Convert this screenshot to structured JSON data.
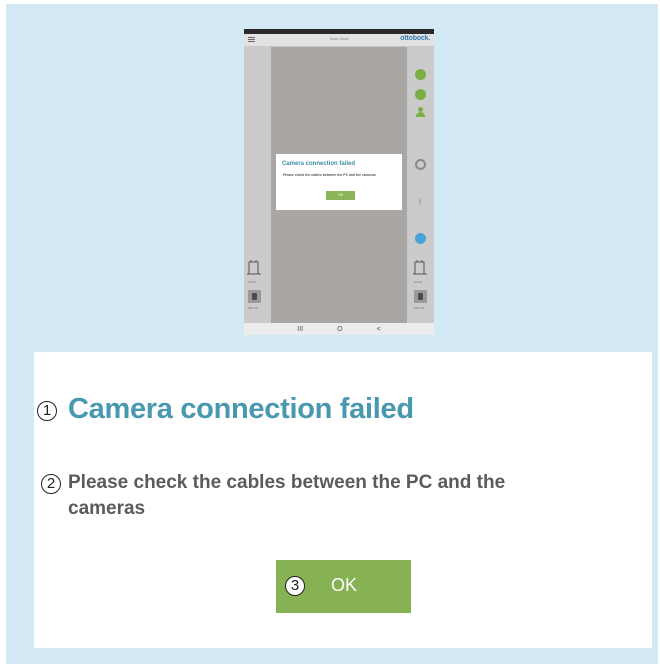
{
  "tablet": {
    "app_title": "Scan View",
    "brand": "ottobock.",
    "left_labels": [
      "SCAN",
      "SETUP"
    ],
    "right_labels": [
      "SCAN",
      "SETUP"
    ],
    "navbar": {
      "recent": "III",
      "home": "O",
      "back": "<"
    },
    "dialog": {
      "title": "Camera connection failed",
      "message": "Please check the cables between the PC and the cameras",
      "ok_label": "OK"
    }
  },
  "zoomed_dialog": {
    "title_callout": "1",
    "title": "Camera connection failed",
    "message_callout": "2",
    "message": "Please check the cables between the PC and the cameras",
    "ok_callout": "3",
    "ok_label": "OK"
  },
  "colors": {
    "background": "#d3e9f4",
    "title_accent": "#4898b0",
    "ok_button": "#86b254",
    "brand": "#3a7ab5"
  }
}
